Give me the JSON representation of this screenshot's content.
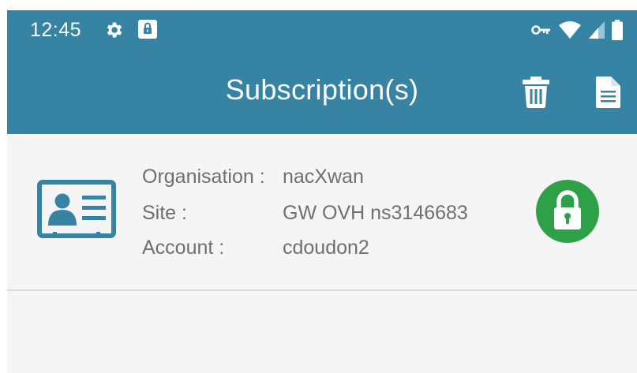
{
  "status_bar": {
    "time": "12:45",
    "icons": [
      "gear-icon",
      "lock-icon",
      "vpn-key-icon",
      "wifi-icon",
      "signal-icon",
      "battery-icon"
    ]
  },
  "app_bar": {
    "title": "Subscription(s)",
    "actions": [
      "delete-icon",
      "document-icon"
    ]
  },
  "subscription": {
    "organisation_label": "Organisation :",
    "organisation_value": "nacXwan",
    "site_label": "Site :",
    "site_value": "GW OVH ns3146683",
    "account_label": "Account :",
    "account_value": "cdoudon2",
    "status_icon": "unlocked-padlock-icon"
  },
  "colors": {
    "primary": "#3683a4",
    "accent_green": "#2ea148",
    "text_secondary": "#6f6f6f",
    "background": "#f5f5f5"
  }
}
